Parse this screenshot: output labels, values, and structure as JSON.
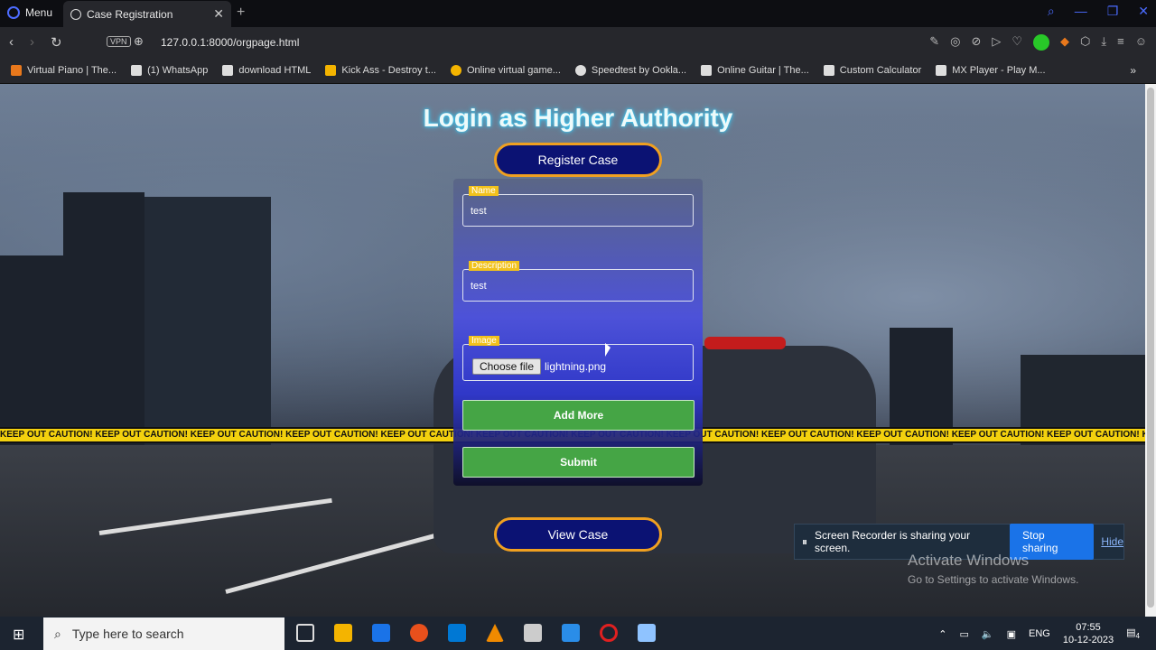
{
  "browser": {
    "menu_label": "Menu",
    "tab_title": "Case Registration",
    "tab_close": "✕",
    "new_tab": "+",
    "vpn_label": "VPN",
    "url": "127.0.0.1:8000/orgpage.html",
    "bookmarks": [
      "Virtual Piano | The...",
      "(1) WhatsApp",
      "download HTML",
      "Kick Ass - Destroy t...",
      "Online virtual game...",
      "Speedtest by Ookla...",
      "Online Guitar | The...",
      "Custom Calculator",
      "MX Player - Play M..."
    ],
    "bookmarks_more": "»"
  },
  "page": {
    "title": "Login as Higher Authority",
    "register_button": "Register Case",
    "view_button": "View Case",
    "form": {
      "name_label": "Name",
      "name_value": "test",
      "description_label": "Description",
      "description_value": "test",
      "image_label": "Image",
      "choose_file_label": "Choose file",
      "file_name": "lightning.png",
      "add_more_label": "Add More",
      "submit_label": "Submit"
    },
    "tape_text": "KEEP OUT CAUTION!  KEEP OUT CAUTION!  KEEP OUT CAUTION!  KEEP OUT CAUTION!  KEEP OUT CAUTION!  KEEP OUT CAUTION!  KEEP OUT CAUTION!  KEEP OUT CAUTION!  KEEP OUT CAUTION!  KEEP OUT CAUTION!  KEEP OUT CAUTION!  KEEP OUT CAUTION!  KEEP OUT CAUTION!  KEEP OUT CAUTION!"
  },
  "screen_share": {
    "message": "Screen Recorder is sharing your screen.",
    "stop_label": "Stop sharing",
    "hide_label": "Hide"
  },
  "watermark": {
    "line1": "Activate Windows",
    "line2": "Go to Settings to activate Windows."
  },
  "taskbar": {
    "search_placeholder": "Type here to search",
    "language": "ENG",
    "time": "07:55",
    "date": "10-12-2023",
    "notification_count": "4"
  },
  "colors": {
    "title_glow": "#37d2ff",
    "pill_bg": "#0b1273",
    "pill_border": "#f0a020",
    "green_button": "#45a545",
    "label_bg": "#f2c21c"
  }
}
